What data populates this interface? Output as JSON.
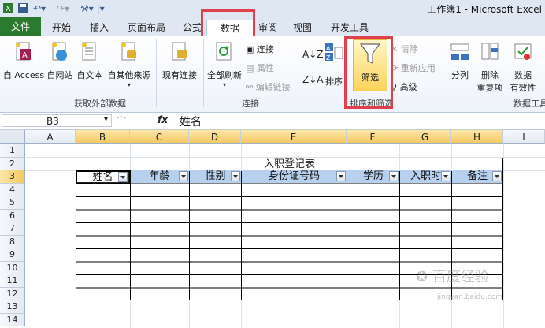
{
  "window": {
    "title": "工作簿1 - Microsoft Excel"
  },
  "tabs": [
    {
      "label": "文件"
    },
    {
      "label": "开始"
    },
    {
      "label": "插入"
    },
    {
      "label": "页面布局"
    },
    {
      "label": "公式"
    },
    {
      "label": "数据"
    },
    {
      "label": "审阅"
    },
    {
      "label": "视图"
    },
    {
      "label": "开发工具"
    }
  ],
  "active_tab": "数据",
  "ribbon": {
    "get_external": {
      "label": "获取外部数据",
      "buttons": [
        "自 Access",
        "自网站",
        "自文本",
        "自其他来源",
        "现有连接"
      ]
    },
    "connections": {
      "label": "连接",
      "refresh_all": "全部刷新",
      "small": [
        "连接",
        "属性",
        "编辑链接"
      ]
    },
    "sort_filter": {
      "label": "排序和筛选",
      "sort": "排序",
      "filter": "筛选",
      "small": [
        "清除",
        "重新应用",
        "高级"
      ]
    },
    "data_tools": {
      "label": "数据工具",
      "buttons": [
        "分列",
        "删除",
        "重复项",
        "数据",
        "有效性"
      ]
    }
  },
  "formula_bar": {
    "name_box": "B3",
    "fx": "fx",
    "content": "姓名"
  },
  "columns": [
    "A",
    "B",
    "C",
    "D",
    "E",
    "F",
    "G",
    "H",
    "I"
  ],
  "rows": [
    "1",
    "2",
    "3",
    "4",
    "5",
    "6",
    "7",
    "8",
    "9",
    "10",
    "11",
    "12",
    "13",
    "14"
  ],
  "sheet": {
    "table_title": "入职登记表",
    "headers": [
      "姓名",
      "年龄",
      "性别",
      "身份证号码",
      "学历",
      "入职时",
      "备注"
    ]
  },
  "watermark": "百度经验",
  "watermark_url": "jingyan.baidu.com",
  "colors": {
    "file_tab": "#2c7a2f",
    "highlight": "#e0404e",
    "selected_header": "#f5c75e",
    "header_fill": "#b6d0ee"
  }
}
